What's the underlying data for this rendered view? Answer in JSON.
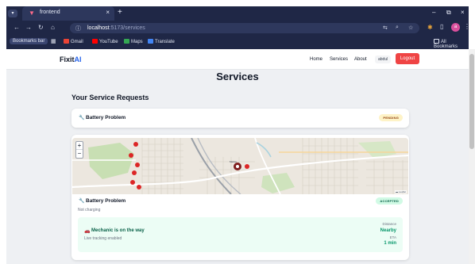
{
  "browser": {
    "tab_title": "frontend",
    "tab_close": "×",
    "new_tab": "+",
    "tab_menu": "▾",
    "window_controls": [
      "–",
      "⧉",
      "×"
    ],
    "url_host": "localhost",
    "url_path": ":5173/services",
    "bookmarks_label": "Bookmarks bar",
    "bookmarks": [
      "Gmail",
      "YouTube",
      "Maps",
      "Translate"
    ],
    "all_bookmarks": "All Bookmarks",
    "profile_initial": "a"
  },
  "nav": {
    "logo_prefix": "Fixit",
    "logo_suffix": "AI",
    "links": [
      "Home",
      "Services",
      "About"
    ],
    "user": "abdul",
    "logout": "Logout"
  },
  "page": {
    "title": "Services",
    "section_title": "Your Service Requests"
  },
  "requests": [
    {
      "title": "Battery Problem",
      "status": "PENDING"
    },
    {
      "title": "Battery Problem",
      "status": "ACCEPTED",
      "description": "Not charging",
      "map": {
        "zoom_in": "+",
        "zoom_out": "−",
        "attribution": "▬ Leaflet"
      },
      "tracking": {
        "title": "Mechanic is on the way",
        "subtitle": "Live tracking enabled",
        "distance_label": "Distance",
        "distance_value": "Nearby",
        "eta_label": "ETA",
        "eta_value": "1 min"
      }
    }
  ],
  "colors": {
    "accent": "#2563eb",
    "logout": "#ef4444",
    "pending_bg": "#fef3c7",
    "accepted_bg": "#d1fae5",
    "tracking_bg": "#ecfdf5"
  }
}
